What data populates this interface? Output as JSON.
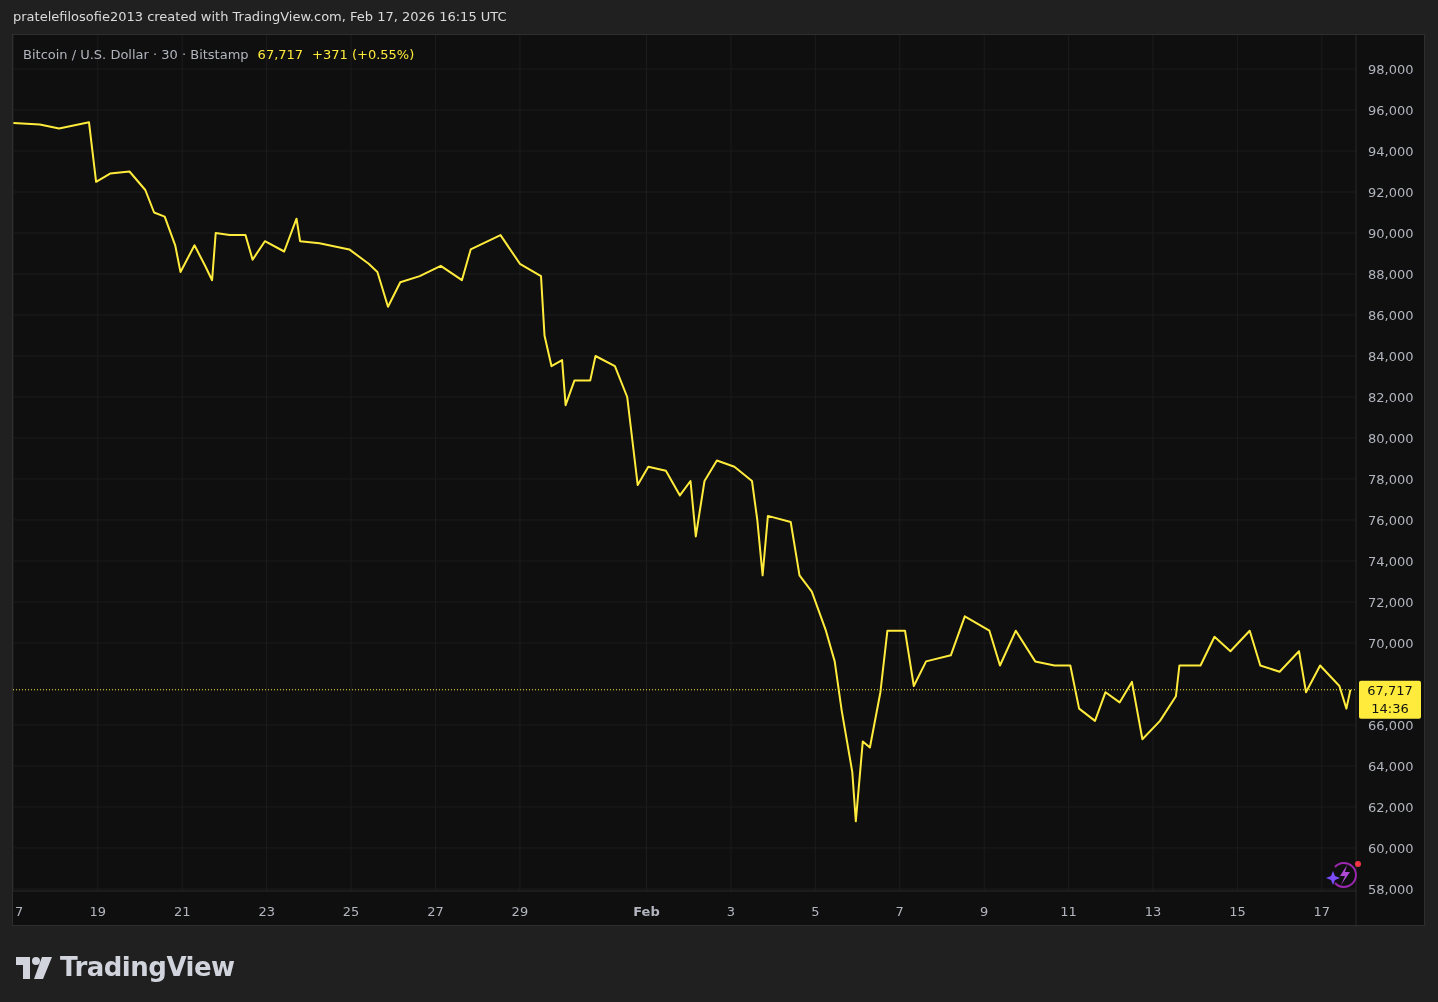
{
  "header": {
    "attribution": "pratelefilosofie2013 created with TradingView.com, Feb 17, 2026 16:15 UTC"
  },
  "legend": {
    "symbol": "Bitcoin / U.S. Dollar · 30 · Bitstamp",
    "price": "67,717",
    "change": "+371 (+0.55%)"
  },
  "price_tag": {
    "price": "67,717",
    "countdown": "14:36"
  },
  "chart_data": {
    "type": "line",
    "grid": true,
    "ref_lines": [
      {
        "axis": "y",
        "value": 67717,
        "color": "#ffeb3b"
      }
    ],
    "xlim": [
      "2026-01-16T23:46",
      "2026-02-17T19:26"
    ],
    "ylim": [
      57900,
      99660
    ],
    "xticks": [
      {
        "value": "2026-01-17T00:00",
        "label": "7"
      },
      {
        "value": "2026-01-19T00:00",
        "label": "19"
      },
      {
        "value": "2026-01-21T00:00",
        "label": "21"
      },
      {
        "value": "2026-01-23T00:00",
        "label": "23"
      },
      {
        "value": "2026-01-25T00:00",
        "label": "25"
      },
      {
        "value": "2026-01-27T00:00",
        "label": "27"
      },
      {
        "value": "2026-01-29T00:00",
        "label": "29"
      },
      {
        "value": "2026-02-01T00:00",
        "label": "Feb"
      },
      {
        "value": "2026-02-03T00:00",
        "label": "3"
      },
      {
        "value": "2026-02-05T00:00",
        "label": "5"
      },
      {
        "value": "2026-02-07T00:00",
        "label": "7"
      },
      {
        "value": "2026-02-09T00:00",
        "label": "9"
      },
      {
        "value": "2026-02-11T00:00",
        "label": "11"
      },
      {
        "value": "2026-02-13T00:00",
        "label": "13"
      },
      {
        "value": "2026-02-15T00:00",
        "label": "15"
      },
      {
        "value": "2026-02-17T00:00",
        "label": "17"
      }
    ],
    "yticks": [
      {
        "value": 58000,
        "label": "58,000"
      },
      {
        "value": 60000,
        "label": "60,000"
      },
      {
        "value": 62000,
        "label": "62,000"
      },
      {
        "value": 64000,
        "label": "64,000"
      },
      {
        "value": 66000,
        "label": "66,000"
      },
      {
        "value": 70000,
        "label": "70,000"
      },
      {
        "value": 72000,
        "label": "72,000"
      },
      {
        "value": 74000,
        "label": "74,000"
      },
      {
        "value": 76000,
        "label": "76,000"
      },
      {
        "value": 78000,
        "label": "78,000"
      },
      {
        "value": 80000,
        "label": "80,000"
      },
      {
        "value": 82000,
        "label": "82,000"
      },
      {
        "value": 84000,
        "label": "84,000"
      },
      {
        "value": 86000,
        "label": "86,000"
      },
      {
        "value": 88000,
        "label": "88,000"
      },
      {
        "value": 90000,
        "label": "90,000"
      },
      {
        "value": 92000,
        "label": "92,000"
      },
      {
        "value": 94000,
        "label": "94,000"
      },
      {
        "value": 96000,
        "label": "96,000"
      },
      {
        "value": 98000,
        "label": "98,000"
      }
    ],
    "x": [
      "2026-01-17T00:00",
      "2026-01-17T15:00",
      "2026-01-18T02:00",
      "2026-01-18T19:00",
      "2026-01-18T23:00",
      "2026-01-19T07:00",
      "2026-01-19T18:00",
      "2026-01-20T03:00",
      "2026-01-20T08:00",
      "2026-01-20T14:00",
      "2026-01-20T20:00",
      "2026-01-20T23:00",
      "2026-01-21T07:00",
      "2026-01-21T13:00",
      "2026-01-21T17:00",
      "2026-01-21T19:00",
      "2026-01-22T03:00",
      "2026-01-22T12:00",
      "2026-01-22T16:00",
      "2026-01-22T23:00",
      "2026-01-23T10:00",
      "2026-01-23T17:00",
      "2026-01-23T19:00",
      "2026-01-24T06:00",
      "2026-01-24T23:00",
      "2026-01-25T10:00",
      "2026-01-25T15:00",
      "2026-01-25T21:00",
      "2026-01-26T04:00",
      "2026-01-26T15:00",
      "2026-01-27T03:00",
      "2026-01-27T15:00",
      "2026-01-27T20:00",
      "2026-01-28T13:00",
      "2026-01-29T00:00",
      "2026-01-29T12:00",
      "2026-01-29T14:00",
      "2026-01-29T18:00",
      "2026-01-30T00:00",
      "2026-01-30T02:00",
      "2026-01-30T07:00",
      "2026-01-30T16:00",
      "2026-01-30T19:00",
      "2026-01-31T06:00",
      "2026-01-31T13:00",
      "2026-01-31T19:00",
      "2026-02-01T01:00",
      "2026-02-01T11:00",
      "2026-02-01T19:00",
      "2026-02-02T01:00",
      "2026-02-02T04:00",
      "2026-02-02T09:00",
      "2026-02-02T16:00",
      "2026-02-03T02:00",
      "2026-02-03T12:00",
      "2026-02-03T15:00",
      "2026-02-03T18:00",
      "2026-02-03T21:00",
      "2026-02-04T10:00",
      "2026-02-04T15:00",
      "2026-02-04T22:00",
      "2026-02-05T06:00",
      "2026-02-05T11:00",
      "2026-02-05T15:00",
      "2026-02-05T21:00",
      "2026-02-05T23:00",
      "2026-02-06T03:00",
      "2026-02-06T07:00",
      "2026-02-06T13:00",
      "2026-02-06T17:00",
      "2026-02-07T03:00",
      "2026-02-07T08:00",
      "2026-02-07T15:00",
      "2026-02-08T05:00",
      "2026-02-08T13:00",
      "2026-02-09T03:00",
      "2026-02-09T09:00",
      "2026-02-09T18:00",
      "2026-02-10T05:00",
      "2026-02-10T16:00",
      "2026-02-11T01:00",
      "2026-02-11T06:00",
      "2026-02-11T15:00",
      "2026-02-11T21:00",
      "2026-02-12T05:00",
      "2026-02-12T12:00",
      "2026-02-12T18:00",
      "2026-02-13T04:00",
      "2026-02-13T13:00",
      "2026-02-13T15:00",
      "2026-02-14T03:00",
      "2026-02-14T11:00",
      "2026-02-14T20:00",
      "2026-02-15T07:00",
      "2026-02-15T13:00",
      "2026-02-16T00:00",
      "2026-02-16T11:00",
      "2026-02-16T15:00",
      "2026-02-16T23:00",
      "2026-02-17T10:00",
      "2026-02-17T14:00",
      "2026-02-17T16:15"
    ],
    "series": [
      {
        "color": "#ffeb3b",
        "values": [
          95370,
          95300,
          95100,
          95400,
          92500,
          92900,
          93000,
          92100,
          91000,
          90800,
          89400,
          88100,
          89400,
          88400,
          87700,
          90000,
          89900,
          89900,
          88700,
          89600,
          89100,
          90700,
          89600,
          89500,
          89200,
          88500,
          88100,
          86400,
          87600,
          87900,
          88400,
          87700,
          89200,
          89900,
          88500,
          87900,
          85000,
          83500,
          83800,
          81600,
          82800,
          82800,
          84000,
          83500,
          82000,
          77700,
          78600,
          78400,
          77200,
          77900,
          75200,
          77900,
          78900,
          78600,
          77900,
          76000,
          73300,
          76200,
          75900,
          73300,
          72500,
          70600,
          69100,
          66700,
          63700,
          61300,
          65200,
          64900,
          67600,
          70600,
          70600,
          67900,
          69100,
          69400,
          71300,
          70600,
          68900,
          70600,
          69100,
          68900,
          68900,
          66800,
          66200,
          67600,
          67100,
          68100,
          65300,
          66200,
          67400,
          68900,
          68900,
          70300,
          69600,
          70600,
          68900,
          68600,
          69600,
          67600,
          68900,
          67900,
          66800,
          67717
        ]
      }
    ]
  },
  "footer": {
    "logo_text": "TradingView"
  }
}
